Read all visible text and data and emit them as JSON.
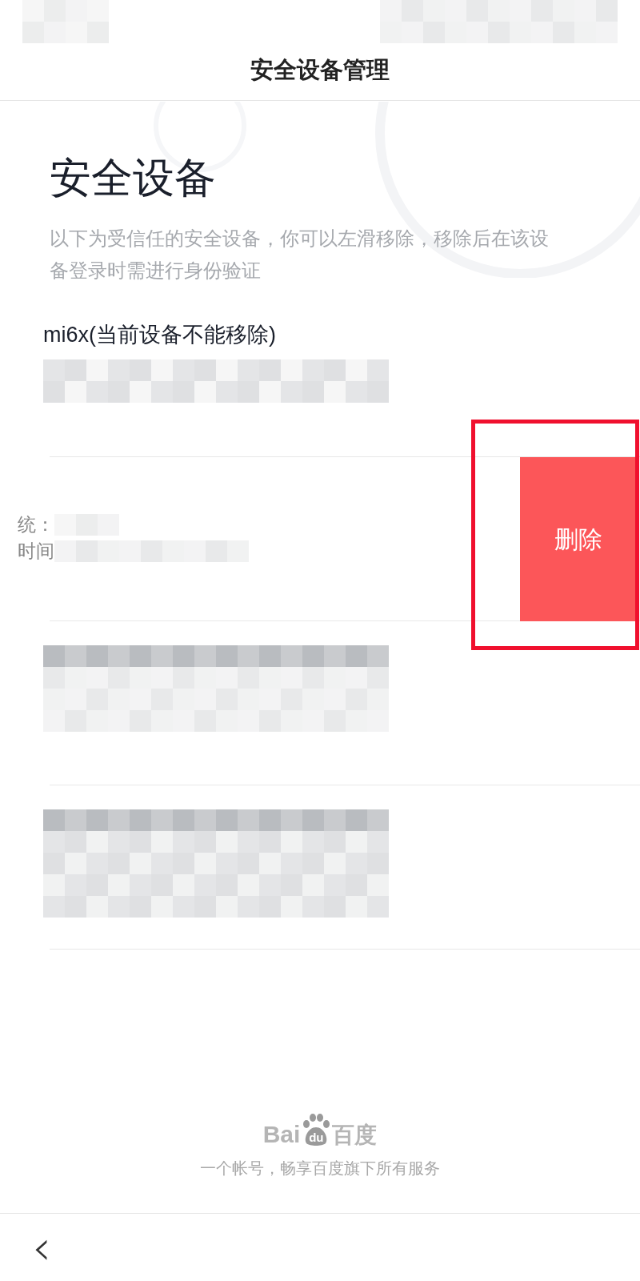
{
  "header": {
    "title": "安全设备管理"
  },
  "heading": "安全设备",
  "description": "以下为受信任的安全设备，你可以左滑移除，移除后在该设备登录时需进行身份验证",
  "devices": [
    {
      "name": "mi6x(当前设备不能移除)",
      "swiped": false,
      "highlighted": false
    },
    {
      "labels": [
        "统：",
        "时间"
      ],
      "swiped": true,
      "action": "删除",
      "highlighted": true
    },
    {
      "swiped": false,
      "highlighted": false
    },
    {
      "swiped": false,
      "highlighted": false
    }
  ],
  "footer": {
    "logo": [
      "Bai",
      "du",
      "百度"
    ],
    "slogan": "一个帐号，畅享百度旗下所有服务"
  },
  "nav": {
    "back": "‹"
  }
}
